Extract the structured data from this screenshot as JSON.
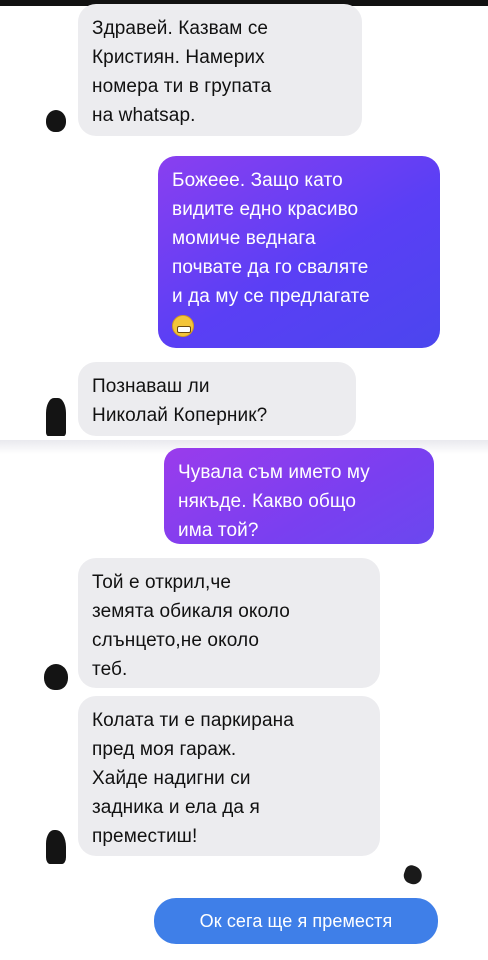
{
  "messages": [
    {
      "id": "m1",
      "from": "them",
      "lines": [
        "Здравей. Казвам се",
        "Кристиян. Намерих",
        "номера ти в групата",
        "на whatsap."
      ]
    },
    {
      "id": "m2",
      "from": "me",
      "lines": [
        "Божеее. Защо като",
        "видите едно красиво",
        "момиче веднага",
        "почвате да го сваляте",
        "и да му се предлагате"
      ],
      "emoji": "grimacing-face-emoji"
    },
    {
      "id": "m3",
      "from": "them",
      "lines": [
        "Познаваш ли",
        "Николай Коперник?"
      ]
    },
    {
      "id": "m4",
      "from": "me",
      "lines": [
        "Чувала съм името му",
        "някъде. Какво общо",
        "има той?"
      ]
    },
    {
      "id": "m5",
      "from": "them",
      "lines": [
        "Той е открил,че",
        "земята обикаля около",
        "слънцето,не около",
        "теб."
      ]
    },
    {
      "id": "m6",
      "from": "them",
      "lines": [
        "Колата ти е паркирана",
        "пред моя гараж.",
        "Хайде надигни си",
        "задника и ела да я",
        "преместиш!"
      ]
    },
    {
      "id": "m7",
      "from": "me",
      "lines": [
        "Ок сега ще я преместя"
      ]
    }
  ],
  "colors": {
    "incoming_bubble": "#ececef",
    "outgoing_purple": "#5a3ff5",
    "outgoing_blue": "#3f7fe8"
  }
}
